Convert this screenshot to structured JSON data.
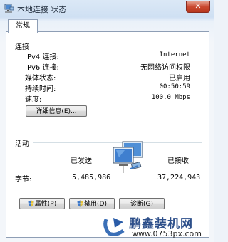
{
  "window": {
    "title": "本地连接 状态",
    "close_glyph": "✕"
  },
  "tab": {
    "label": "常规"
  },
  "connection": {
    "section_title": "连接",
    "rows": [
      {
        "label": "IPv4 连接:",
        "value": "Internet"
      },
      {
        "label": "IPv6 连接:",
        "value": "无网络访问权限"
      },
      {
        "label": "媒体状态:",
        "value": "已启用"
      },
      {
        "label": "持续时间:",
        "value": "00:50:59"
      },
      {
        "label": "速度:",
        "value": "100.0 Mbps"
      }
    ],
    "details_button": "详细信息(E)..."
  },
  "activity": {
    "section_title": "活动",
    "sent_label": "已发送",
    "received_label": "已接收",
    "bytes_label": "字节:",
    "bytes_sent": "5,485,986",
    "bytes_received": "37,224,943",
    "icon": "network-computers-icon"
  },
  "buttons": {
    "properties": "属性(P)",
    "disable": "禁用(D)",
    "diagnose": "诊断(G)"
  },
  "watermark": {
    "title": "鹏鑫装机网",
    "url": "www.0753px.com"
  }
}
